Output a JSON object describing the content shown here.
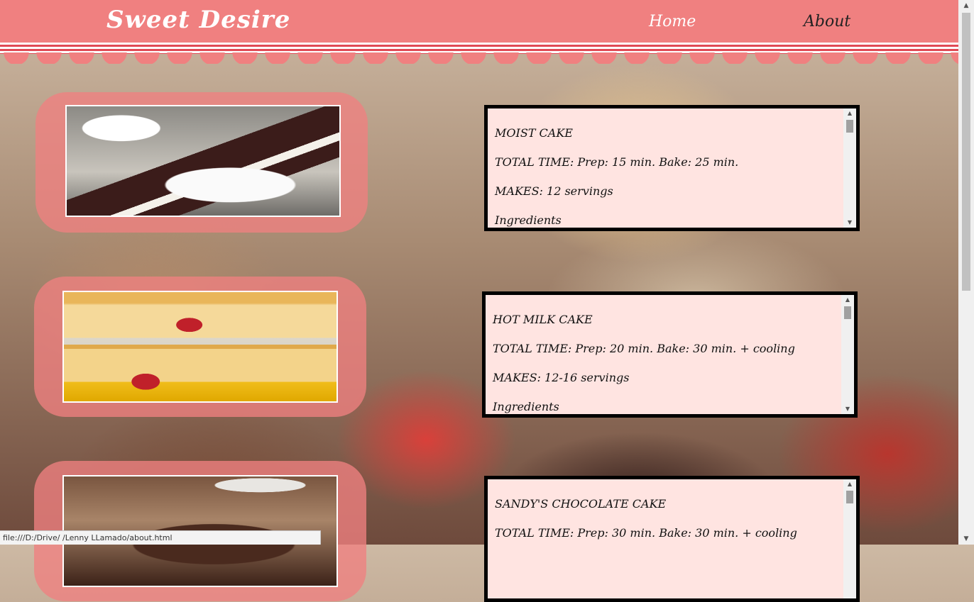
{
  "header": {
    "brand": "Sweet Desire",
    "nav": [
      {
        "label": "Home"
      },
      {
        "label": "About"
      }
    ]
  },
  "recipes": [
    {
      "title": "MOIST CAKE",
      "total_time": "TOTAL TIME: Prep: 15 min. Bake: 25 min.",
      "makes": "MAKES: 12 servings",
      "ingredients_label": "Ingredients"
    },
    {
      "title": "HOT MILK CAKE",
      "total_time": "TOTAL TIME: Prep: 20 min. Bake: 30 min. + cooling",
      "makes": "MAKES: 12-16 servings",
      "ingredients_label": "Ingredients"
    },
    {
      "title": "SANDY'S CHOCOLATE CAKE",
      "total_time": "TOTAL TIME: Prep: 30 min. Bake: 30 min. + cooling"
    }
  ],
  "scroll_arrows": {
    "up": "▲",
    "down": "▼"
  },
  "status_bar": "file:///D:/Drive/ /Lenny LLamado/about.html",
  "colors": {
    "header_bg": "#f08080",
    "frame_bg": "#f08080",
    "recipe_bg": "#ffe4e1",
    "recipe_border": "#000000"
  }
}
